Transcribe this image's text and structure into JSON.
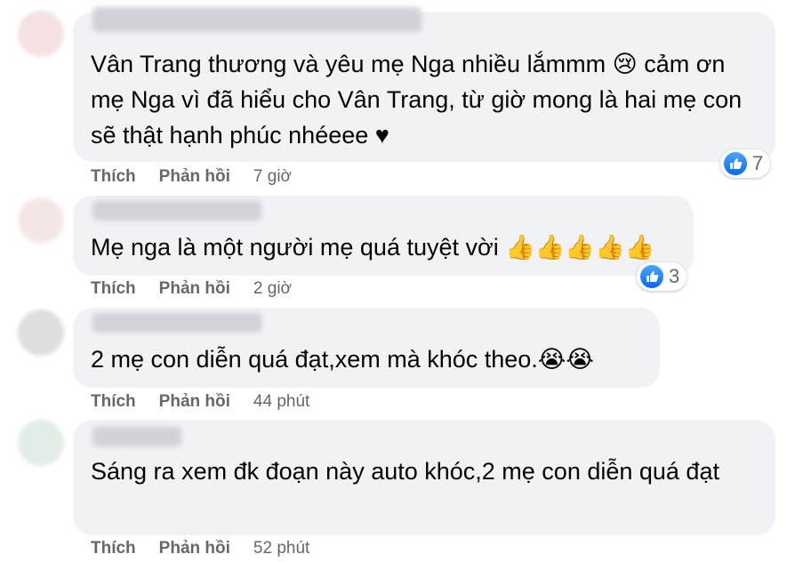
{
  "comments": [
    {
      "text": "Vân Trang thương và yêu mẹ Nga nhiều lắmmm 😢 cảm ơn mẹ Nga vì đã hiểu cho Vân Trang, từ giờ mong là hai mẹ con sẽ thật hạnh phúc nhéeee ♥",
      "like_label": "Thích",
      "reply_label": "Phản hồi",
      "time": "7 giờ",
      "reaction_count": "7"
    },
    {
      "text": "Mẹ nga là một người mẹ quá tuyệt vời 👍👍👍👍👍",
      "like_label": "Thích",
      "reply_label": "Phản hồi",
      "time": "2 giờ",
      "reaction_count": "3"
    },
    {
      "text": "2 mẹ con diễn quá đạt,xem mà khóc theo.😭😭",
      "like_label": "Thích",
      "reply_label": "Phản hồi",
      "time": "44 phút"
    },
    {
      "text": "Sáng ra xem đk đoạn này auto khóc,2 mẹ con diễn quá đạt",
      "like_label": "Thích",
      "reply_label": "Phản hồi",
      "time": "52 phút"
    }
  ],
  "icons": {
    "like_reaction": "thumbs-up-icon",
    "bubble_bg": "#f0f2f5",
    "like_blue": "#0866ff"
  }
}
